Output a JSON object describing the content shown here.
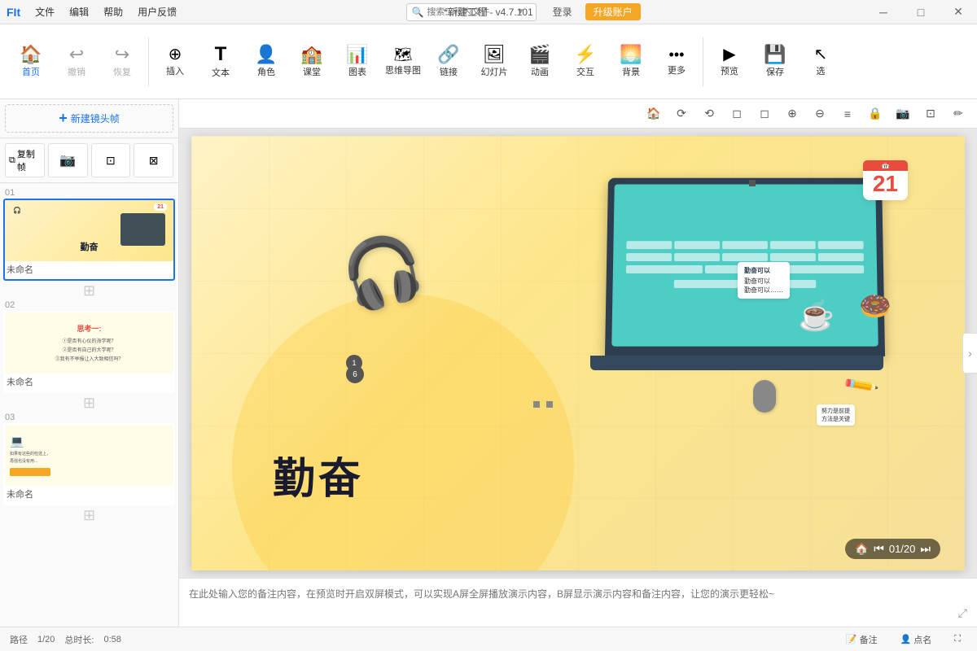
{
  "titlebar": {
    "logo": "FIt",
    "menus": [
      "文件",
      "编辑",
      "帮助",
      "用户反馈"
    ],
    "title": "*新建工程 - v4.7.101",
    "search_placeholder": "搜索工程内文件",
    "login_label": "登录",
    "upgrade_label": "升级账户",
    "win_min": "─",
    "win_max": "□",
    "win_close": "✕"
  },
  "toolbar": {
    "items": [
      {
        "label": "首页",
        "icon": "🏠"
      },
      {
        "label": "撤销",
        "icon": "↩"
      },
      {
        "label": "恢复",
        "icon": "↪"
      },
      {
        "label": "插入",
        "icon": "➕"
      },
      {
        "label": "文本",
        "icon": "T"
      },
      {
        "label": "角色",
        "icon": "👤"
      },
      {
        "label": "课堂",
        "icon": "🏫"
      },
      {
        "label": "图表",
        "icon": "📊"
      },
      {
        "label": "思维导图",
        "icon": "🔀"
      },
      {
        "label": "链接",
        "icon": "🔗"
      },
      {
        "label": "幻灯片",
        "icon": "🖼"
      },
      {
        "label": "动画",
        "icon": "🎬"
      },
      {
        "label": "交互",
        "icon": "⚡"
      },
      {
        "label": "背景",
        "icon": "🌅"
      },
      {
        "label": "更多",
        "icon": "···"
      },
      {
        "label": "预览",
        "icon": "▶"
      },
      {
        "label": "保存",
        "icon": "💾"
      },
      {
        "label": "选",
        "icon": "↗"
      }
    ]
  },
  "sidebar": {
    "new_scene_label": "新建镜头帧",
    "tools": [
      "复制帧",
      "📷",
      "⊡",
      "⊠"
    ],
    "slides": [
      {
        "num": "01",
        "name": "未命名",
        "content": "勤奋",
        "type": "main"
      },
      {
        "num": "02",
        "name": "未命名",
        "content": "思考一:",
        "type": "think"
      },
      {
        "num": "03",
        "name": "未命名",
        "content": "",
        "type": "content"
      }
    ]
  },
  "canvas": {
    "slide_title": "勤奋",
    "calendar_num": "21",
    "grid_visible": true
  },
  "canvas_toolbar": {
    "buttons": [
      "🏠",
      "⟳",
      "⟲",
      "◻",
      "◻",
      "⊕",
      "⊖",
      "≡",
      "🔒",
      "📷",
      "⊡",
      "✏"
    ]
  },
  "notes": {
    "placeholder": "在此处输入您的备注内容，在预览时开启双屏模式，可以实现A屏全屏播放演示内容，B屏显示演示内容和备注内容，让您的演示更轻松~"
  },
  "playbar": {
    "path_label": "路径",
    "path_value": "1/20",
    "total_label": "总时长:",
    "total_value": "0:58",
    "notes_btn": "备注",
    "roll_btn": "点名",
    "page_counter": "01/20"
  }
}
